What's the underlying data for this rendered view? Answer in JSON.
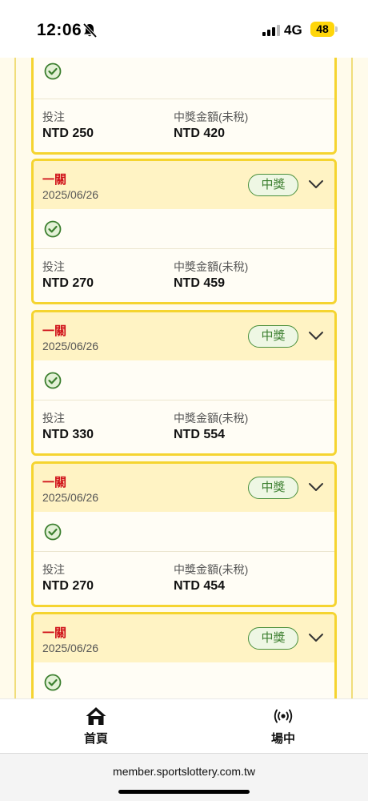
{
  "status_bar": {
    "time": "12:06",
    "network": "4G",
    "battery": "48"
  },
  "cards": [
    {
      "partial": true,
      "type": "",
      "date": "",
      "badge": "",
      "bet_label": "投注",
      "bet_value": "NTD 250",
      "prize_label": "中獎金額(未稅)",
      "prize_value": "NTD 420"
    },
    {
      "partial": false,
      "type": "一關",
      "date": "2025/06/26",
      "badge": "中獎",
      "bet_label": "投注",
      "bet_value": "NTD 270",
      "prize_label": "中獎金額(未稅)",
      "prize_value": "NTD 459"
    },
    {
      "partial": false,
      "type": "一關",
      "date": "2025/06/26",
      "badge": "中獎",
      "bet_label": "投注",
      "bet_value": "NTD 330",
      "prize_label": "中獎金額(未稅)",
      "prize_value": "NTD 554"
    },
    {
      "partial": false,
      "type": "一關",
      "date": "2025/06/26",
      "badge": "中獎",
      "bet_label": "投注",
      "bet_value": "NTD 270",
      "prize_label": "中獎金額(未稅)",
      "prize_value": "NTD 454"
    },
    {
      "partial": false,
      "type": "一關",
      "date": "2025/06/26",
      "badge": "中獎",
      "bet_label": "",
      "bet_value": "",
      "prize_label": "",
      "prize_value": ""
    }
  ],
  "bottom_nav": {
    "home_label": "首頁",
    "live_label": "場中"
  },
  "browser": {
    "url": "member.sportslottery.com.tw"
  },
  "colors": {
    "accent_yellow": "#f5d430",
    "header_bg": "#fff3c4",
    "type_red": "#d0141b",
    "win_green": "#3c7f2f"
  }
}
